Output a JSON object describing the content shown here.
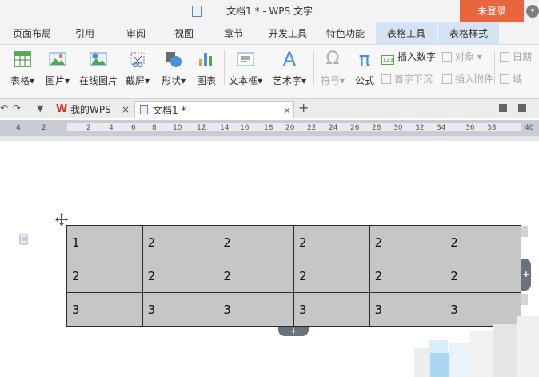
{
  "window": {
    "title": "文档1 * - WPS 文字",
    "login_label": "未登录"
  },
  "menu_tabs": [
    {
      "label": "页面布局"
    },
    {
      "label": "引用"
    },
    {
      "label": "审阅"
    },
    {
      "label": "视图"
    },
    {
      "label": "章节"
    },
    {
      "label": "开发工具"
    },
    {
      "label": "特色功能"
    },
    {
      "label": "表格工具"
    },
    {
      "label": "表格样式"
    }
  ],
  "ribbon": {
    "tools": [
      {
        "label": "表格",
        "icon": "table-icon",
        "dropdown": "▾"
      },
      {
        "label": "图片",
        "icon": "picture-icon",
        "dropdown": "▾"
      },
      {
        "label": "在线图片",
        "icon": "online-picture-icon"
      },
      {
        "label": "截屏",
        "icon": "screenshot-icon",
        "dropdown": "▾"
      },
      {
        "label": "形状",
        "icon": "shapes-icon",
        "dropdown": "▾"
      },
      {
        "label": "图表",
        "icon": "chart-icon"
      },
      {
        "label": "文本框",
        "icon": "textbox-icon",
        "dropdown": "▾"
      },
      {
        "label": "艺术字",
        "icon": "wordart-icon",
        "dropdown": "▾"
      },
      {
        "label": "符号",
        "icon": "symbol-icon",
        "dropdown": "▾"
      },
      {
        "label": "公式",
        "icon": "formula-icon"
      }
    ],
    "small": {
      "insert_number": "插入数字",
      "object": "对象",
      "dropcap": "首字下沉",
      "insert_attachment": "插入附件",
      "date": "日期",
      "field": "域"
    },
    "icon_glyphs": {
      "symbol": "Ω",
      "formula": "π",
      "wordart": "A",
      "number": "123"
    }
  },
  "doc_tabs": [
    {
      "label": "我的WPS",
      "close": "×"
    },
    {
      "label": "文档1 *",
      "close": "×"
    }
  ],
  "new_tab": "+",
  "ruler_numbers": [
    "4",
    "2",
    "2",
    "4",
    "6",
    "8",
    "10",
    "12",
    "14",
    "16",
    "18",
    "20",
    "22",
    "24",
    "26",
    "28",
    "30",
    "32",
    "34",
    "36",
    "38",
    "40"
  ],
  "table": {
    "rows": [
      [
        "1",
        "2",
        "2",
        "2",
        "2",
        "2"
      ],
      [
        "2",
        "2",
        "2",
        "2",
        "2",
        "2"
      ],
      [
        "3",
        "3",
        "3",
        "3",
        "3",
        "3"
      ]
    ],
    "add_glyph": "+"
  },
  "colors": {
    "login": "#e8653d",
    "ribbon_bg": "#f7f7f7",
    "ctx_tab": "#d6e3f4",
    "cell_fill": "#c6c6c6",
    "handle": "#6b7178"
  }
}
